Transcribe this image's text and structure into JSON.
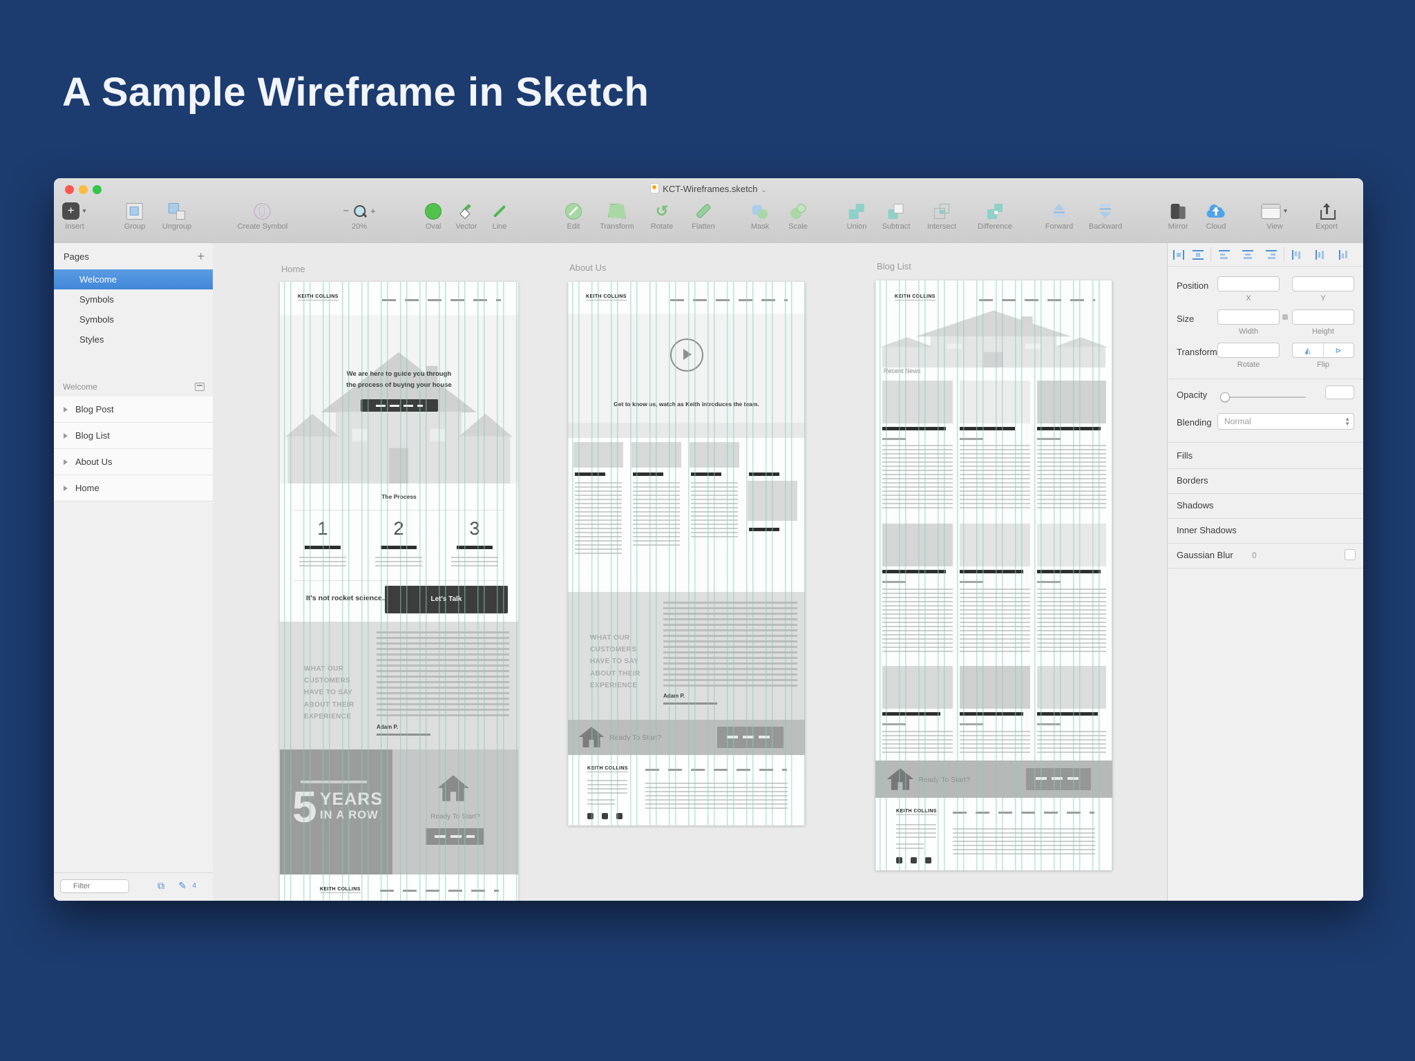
{
  "page_title": "A Sample Wireframe in Sketch",
  "window_title": "KCT-Wireframes.sketch",
  "toolbar": {
    "items": [
      "Insert",
      "Group",
      "Ungroup",
      "Create Symbol",
      "20%",
      "Oval",
      "Vector",
      "Line",
      "Edit",
      "Transform",
      "Rotate",
      "Flatten",
      "Mask",
      "Scale",
      "Union",
      "Subtract",
      "Intersect",
      "Difference",
      "Forward",
      "Backward",
      "Mirror",
      "Cloud",
      "View",
      "Export"
    ]
  },
  "sidebar": {
    "pages_header": "Pages",
    "add_button": "+",
    "pages": [
      "Welcome",
      "Symbols",
      "Symbols",
      "Styles"
    ],
    "section_header": "Welcome",
    "layers": [
      "Blog Post",
      "Blog List",
      "About Us",
      "Home"
    ],
    "filter_placeholder": "Filter",
    "layers_badge": "4"
  },
  "inspector": {
    "position_label": "Position",
    "x_label": "X",
    "y_label": "Y",
    "size_label": "Size",
    "width_label": "Width",
    "height_label": "Height",
    "transform_label": "Transform",
    "rotate_label": "Rotate",
    "flip_label": "Flip",
    "opacity_label": "Opacity",
    "blending_label": "Blending",
    "blending_value": "Normal",
    "fills_label": "Fills",
    "borders_label": "Borders",
    "shadows_label": "Shadows",
    "inner_shadows_label": "Inner Shadows",
    "gaussian_blur_label": "Gaussian Blur",
    "gaussian_blur_value": "0"
  },
  "canvas": {
    "home": {
      "label": "Home",
      "logo": "KEITH COLLINS",
      "hero_line1": "We are here to guide you through",
      "hero_line2": "the process of buying your house",
      "process_title": "The Process",
      "steps": [
        "1",
        "2",
        "3"
      ],
      "cta_text": "It's not rocket science...",
      "cta_button": "Let's Talk",
      "testimonial": [
        "WHAT OUR",
        "CUSTOMERS",
        "HAVE TO SAY",
        "ABOUT THEIR",
        "EXPERIENCE"
      ],
      "testimonial_author": "Adam P.",
      "banner_number": "5",
      "banner_word1": "YEARS",
      "banner_word2": "IN A ROW",
      "ready_text": "Ready To Start?"
    },
    "about": {
      "label": "About Us",
      "logo": "KEITH COLLINS",
      "hero_text": "Get to know us, watch as Keith introduces the team.",
      "testimonial": [
        "WHAT OUR",
        "CUSTOMERS",
        "HAVE TO SAY",
        "ABOUT THEIR",
        "EXPERIENCE"
      ],
      "testimonial_author": "Adam P.",
      "ready_text": "Ready To Start?"
    },
    "blog": {
      "label": "Blog List",
      "logo": "KEITH COLLINS",
      "recent_news": "Recent News",
      "ready_text": "Ready To Start?"
    }
  },
  "colors": {
    "background_navy": "#1c3b6e",
    "accent_blue": "#4a90d9",
    "guide_teal": "#7ad3bb",
    "traffic_red": "#fc5753",
    "traffic_yellow": "#fdbc40",
    "traffic_green": "#33c748"
  }
}
